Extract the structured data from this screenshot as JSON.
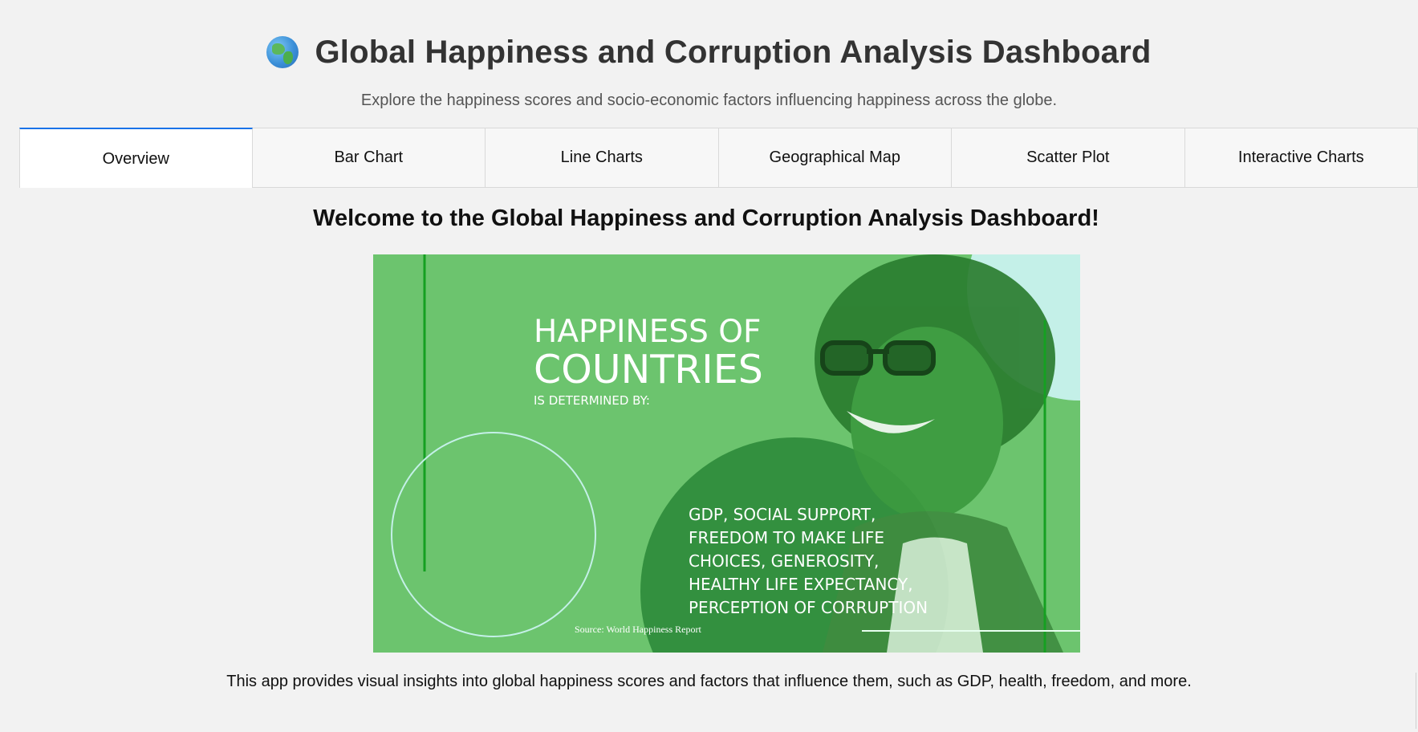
{
  "header": {
    "icon": "globe-icon",
    "title": "Global Happiness and Corruption Analysis Dashboard",
    "subtitle": "Explore the happiness scores and socio-economic factors influencing happiness across the globe."
  },
  "tabs": [
    {
      "label": "Overview",
      "active": true
    },
    {
      "label": "Bar Chart",
      "active": false
    },
    {
      "label": "Line Charts",
      "active": false
    },
    {
      "label": "Geographical Map",
      "active": false
    },
    {
      "label": "Scatter Plot",
      "active": false
    },
    {
      "label": "Interactive Charts",
      "active": false
    }
  ],
  "overview": {
    "welcome": "Welcome to the Global Happiness and Corruption Analysis Dashboard!",
    "banner": {
      "headline_line1": "HAPPINESS OF",
      "headline_line2": "COUNTRIES",
      "headline_line3": "IS DETERMINED BY:",
      "factors": [
        "GDP, SOCIAL SUPPORT,",
        "FREEDOM TO MAKE LIFE",
        "CHOICES, GENEROSITY,",
        "HEALTHY LIFE EXPECTANCY,",
        "PERCEPTION OF CORRUPTION"
      ],
      "source": "Source: World Happiness Report"
    },
    "description": "This app provides visual insights into global happiness scores and factors that influence them, such as GDP, health, freedom, and more."
  },
  "colors": {
    "accent": "#1a73e8",
    "banner_green": "#6cc46e",
    "banner_dark_green": "#2e8b3a",
    "banner_mint": "#c4f0e8"
  }
}
